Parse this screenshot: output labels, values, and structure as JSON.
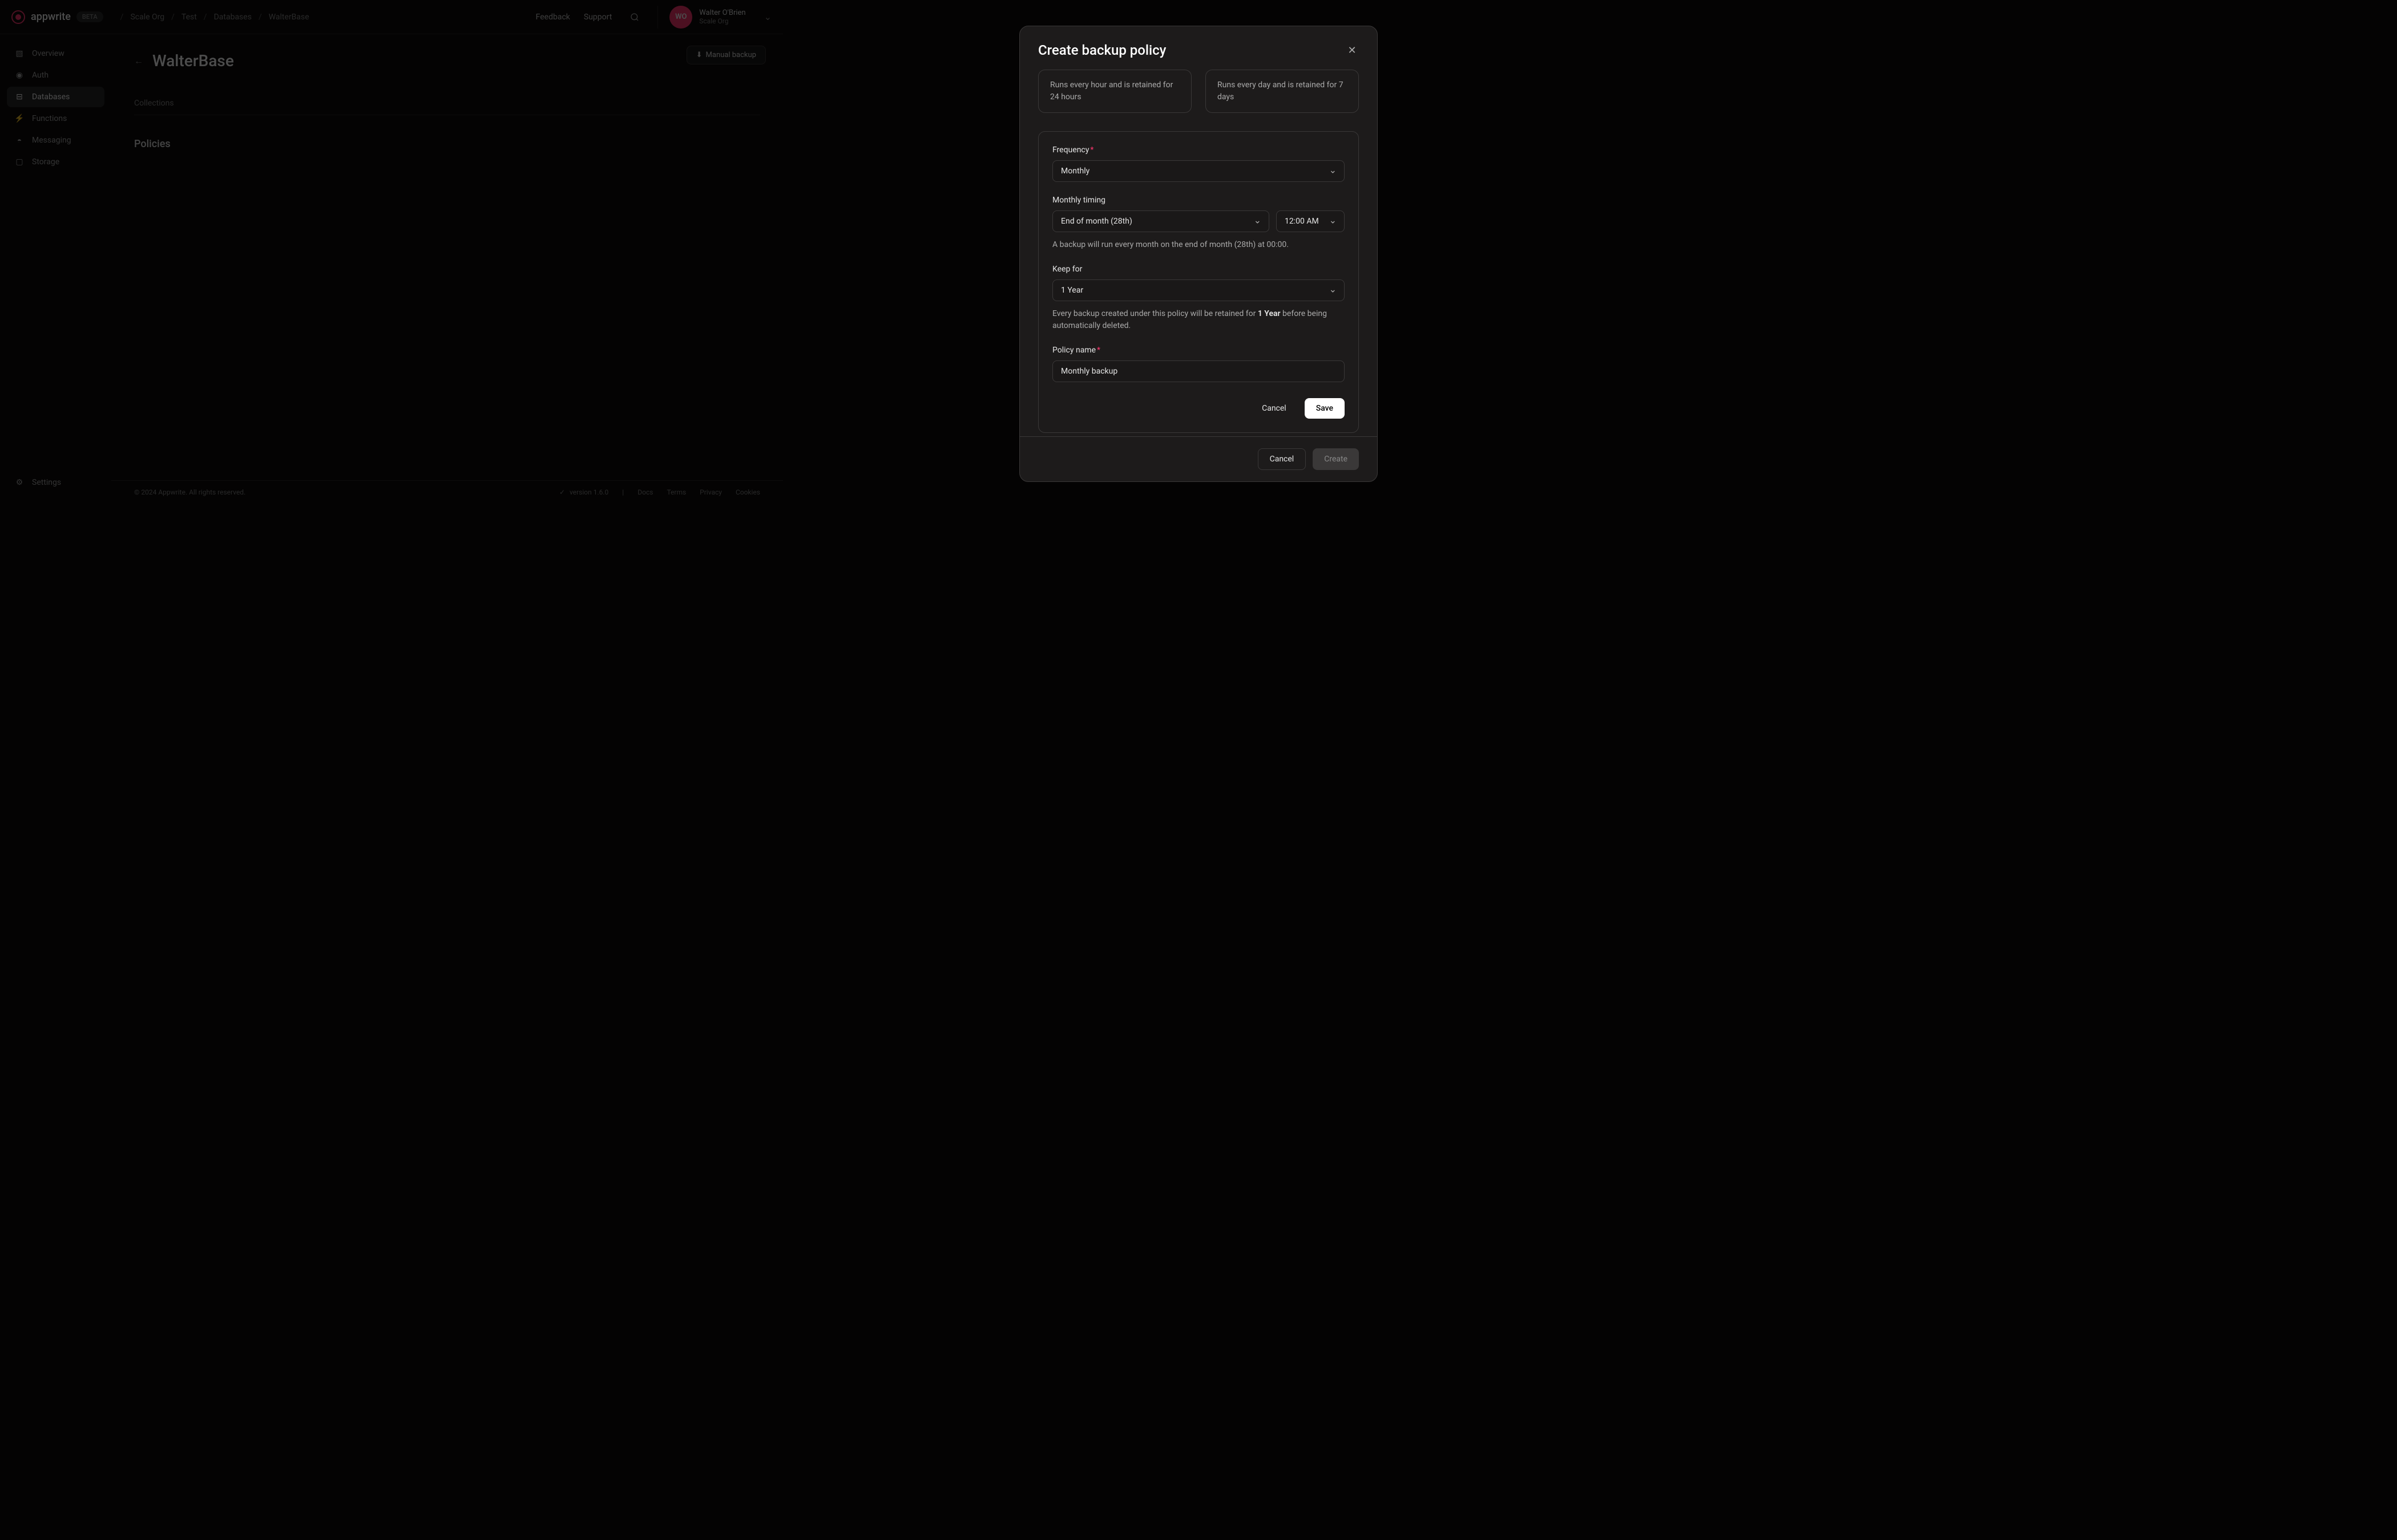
{
  "header": {
    "logo_text": "appwrite",
    "beta": "BETA",
    "breadcrumb": [
      "Scale Org",
      "Test",
      "Databases",
      "WalterBase"
    ],
    "feedback": "Feedback",
    "support": "Support",
    "user_avatar": "WO",
    "user_name": "Walter O'Brien",
    "user_org": "Scale Org"
  },
  "sidebar": {
    "items": [
      {
        "label": "Overview",
        "icon": "chart-icon"
      },
      {
        "label": "Auth",
        "icon": "user-icon"
      },
      {
        "label": "Databases",
        "icon": "database-icon",
        "active": true
      },
      {
        "label": "Functions",
        "icon": "lightning-icon"
      },
      {
        "label": "Messaging",
        "icon": "chat-icon"
      },
      {
        "label": "Storage",
        "icon": "folder-icon"
      }
    ],
    "settings": "Settings"
  },
  "page": {
    "title": "WalterBase",
    "tabs": [
      "Collections"
    ],
    "section": "Policies",
    "manual_backup": "Manual backup"
  },
  "modal": {
    "title": "Create backup policy",
    "presets": [
      {
        "desc": "Runs every hour and is retained for 24 hours"
      },
      {
        "desc": "Runs every day and is retained for 7 days"
      }
    ],
    "form": {
      "frequency_label": "Frequency",
      "frequency_value": "Monthly",
      "monthly_timing_label": "Monthly timing",
      "monthly_timing_value": "End of month (28th)",
      "time_value": "12:00 AM",
      "frequency_helper": "A backup will run every month on the end of month (28th) at 00:00.",
      "keep_for_label": "Keep for",
      "keep_for_value": "1 Year",
      "retention_helper_1": "Every backup created under this policy will be retained for ",
      "retention_helper_bold": "1 Year",
      "retention_helper_2": " before being automatically deleted.",
      "policy_name_label": "Policy name",
      "policy_name_value": "Monthly backup"
    },
    "inner_cancel": "Cancel",
    "inner_save": "Save",
    "footer_cancel": "Cancel",
    "footer_create": "Create"
  },
  "footer": {
    "copyright": "© 2024 Appwrite. All rights reserved.",
    "version": "version 1.6.0",
    "links": [
      "Docs",
      "Terms",
      "Privacy",
      "Cookies"
    ]
  }
}
